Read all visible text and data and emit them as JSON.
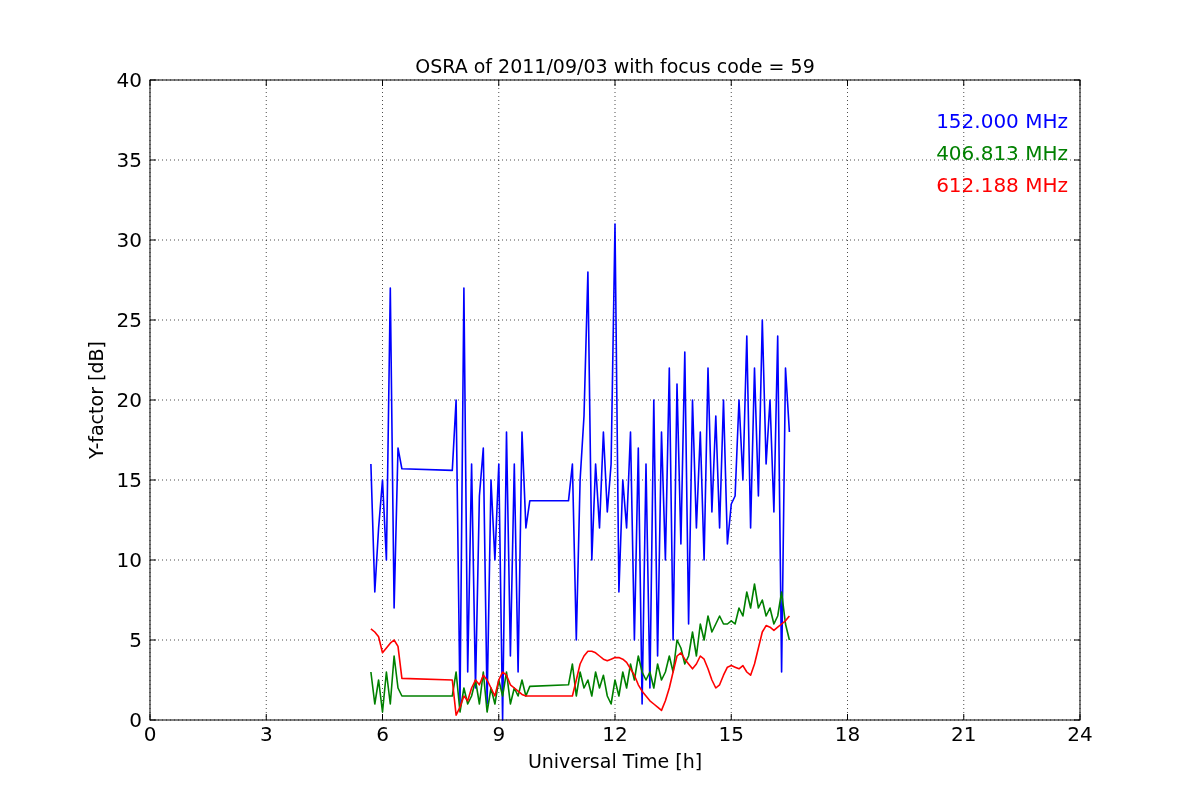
{
  "chart_data": {
    "type": "line",
    "title": "OSRA of 2011/09/03 with focus code = 59",
    "xlabel": "Universal Time [h]",
    "ylabel": "Y-factor [dB]",
    "xlim": [
      0,
      24
    ],
    "ylim": [
      0,
      40
    ],
    "xticks": [
      0,
      3,
      6,
      9,
      12,
      15,
      18,
      21,
      24
    ],
    "yticks": [
      0,
      5,
      10,
      15,
      20,
      25,
      30,
      35,
      40
    ],
    "grid": true,
    "x": [
      5.7,
      5.8,
      5.9,
      6.0,
      6.1,
      6.2,
      6.3,
      6.4,
      6.5,
      7.8,
      7.9,
      8.0,
      8.1,
      8.2,
      8.3,
      8.4,
      8.5,
      8.6,
      8.7,
      8.8,
      8.9,
      9.0,
      9.1,
      9.2,
      9.3,
      9.4,
      9.5,
      9.6,
      9.7,
      9.8,
      10.8,
      10.9,
      11.0,
      11.1,
      11.2,
      11.3,
      11.4,
      11.5,
      11.6,
      11.7,
      11.8,
      11.9,
      12.0,
      12.1,
      12.2,
      12.3,
      12.4,
      12.5,
      12.6,
      12.7,
      12.8,
      12.9,
      13.0,
      13.1,
      13.2,
      13.3,
      13.4,
      13.5,
      13.6,
      13.7,
      13.8,
      13.9,
      14.0,
      14.1,
      14.2,
      14.3,
      14.4,
      14.5,
      14.6,
      14.7,
      14.8,
      14.9,
      15.0,
      15.1,
      15.2,
      15.3,
      15.4,
      15.5,
      15.6,
      15.7,
      15.8,
      15.9,
      16.0,
      16.1,
      16.2,
      16.3,
      16.4,
      16.5
    ],
    "series": [
      {
        "name": "152.000 MHz",
        "color": "#0000ff",
        "values": [
          16,
          8,
          12,
          15,
          10,
          27,
          7,
          17,
          15.7,
          15.6,
          20,
          1,
          27,
          3,
          16,
          2,
          14,
          17,
          1,
          15,
          10,
          16,
          0,
          18,
          4,
          16,
          3,
          18,
          12,
          13.7,
          13.7,
          16,
          5,
          15,
          19,
          28,
          10,
          16,
          12,
          18,
          13,
          16,
          31,
          8,
          15,
          12,
          18,
          5,
          17,
          1,
          16,
          2,
          20,
          4,
          18,
          10,
          22,
          5,
          21,
          11,
          23,
          6,
          20,
          12,
          18,
          10,
          22,
          13,
          19,
          12,
          20,
          11,
          13.5,
          14,
          20,
          15,
          24,
          12,
          22,
          14,
          25,
          16,
          20,
          13,
          24,
          3,
          22,
          18
        ]
      },
      {
        "name": "406.813 MHz",
        "color": "#008000",
        "values": [
          3,
          1,
          2.5,
          0.5,
          3,
          1,
          4,
          2,
          1.5,
          1.5,
          3,
          0.5,
          2,
          1,
          1.5,
          2.5,
          1,
          3,
          0.5,
          2,
          1,
          2.5,
          1.5,
          3,
          1,
          2,
          1.5,
          2.5,
          1.5,
          2.1,
          2.2,
          3.5,
          1.5,
          3,
          2,
          2.5,
          1.5,
          3,
          2,
          2.8,
          1.5,
          1,
          2.5,
          1.5,
          3,
          2,
          3.5,
          2.5,
          4,
          3,
          2.5,
          3,
          2,
          3.5,
          2.5,
          3,
          4,
          3,
          5,
          4.5,
          3.5,
          4,
          5.5,
          4,
          6,
          5,
          6.5,
          5.5,
          6,
          6.5,
          6,
          6,
          6.2,
          6,
          7,
          6.5,
          8,
          7,
          8.5,
          7,
          7.5,
          6.5,
          7,
          6,
          6.5,
          8,
          6,
          5
        ]
      },
      {
        "name": "612.188 MHz",
        "color": "#ff0000",
        "values": [
          5.7,
          5.5,
          5.2,
          4.2,
          4.5,
          4.8,
          5,
          4.6,
          2.6,
          2.5,
          0.3,
          0.8,
          1.5,
          1.2,
          2,
          2.5,
          2.2,
          2.8,
          2.5,
          2,
          1.5,
          2.5,
          3,
          2.8,
          2.2,
          2,
          1.8,
          1.6,
          1.5,
          1.5,
          1.5,
          1.5,
          2.5,
          3.5,
          4,
          4.3,
          4.3,
          4.2,
          4,
          3.8,
          3.7,
          3.8,
          3.9,
          3.9,
          3.8,
          3.6,
          3.2,
          2.8,
          2.2,
          1.8,
          1.5,
          1.2,
          1,
          0.8,
          0.6,
          1.2,
          2,
          3,
          4,
          4.2,
          3.8,
          3.5,
          3.2,
          3.5,
          4,
          3.8,
          3.2,
          2.5,
          2,
          2.2,
          2.8,
          3.3,
          3.4,
          3.3,
          3.2,
          3.4,
          3,
          2.8,
          3.5,
          4.5,
          5.5,
          5.9,
          5.8,
          5.6,
          5.8,
          6,
          6.2,
          6.5
        ]
      }
    ]
  }
}
